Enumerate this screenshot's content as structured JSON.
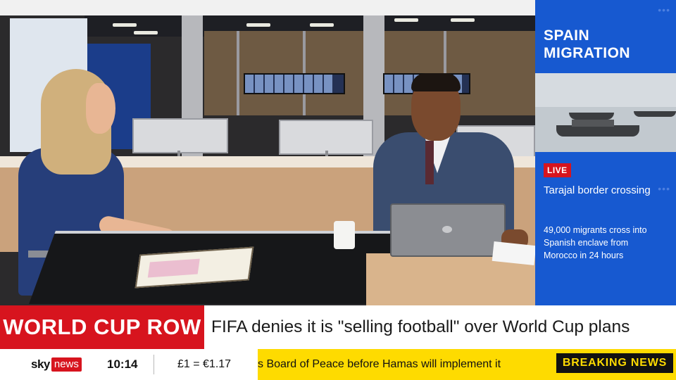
{
  "side_panel": {
    "title_line1": "SPAIN",
    "title_line2": "MIGRATION",
    "live_badge": "LIVE",
    "heading": "Tarajal border crossing",
    "body": "49,000 migrants cross into Spanish enclave from Morocco in 24 hours",
    "accent_color": "#1759d0"
  },
  "headline": {
    "label": "WORLD CUP ROW",
    "text": "FIFA denies it is \"selling football\" over World Cup plans",
    "label_color": "#d7141e"
  },
  "ticker": {
    "logo_sky": "sky",
    "logo_news": "news",
    "time": "10:14",
    "exchange_rate": "£1 = €1.17",
    "crawl_text": "s Board of Peace before Hamas will implement it",
    "breaking_label": "BREAKING NEWS",
    "crawl_color": "#fedb00"
  }
}
